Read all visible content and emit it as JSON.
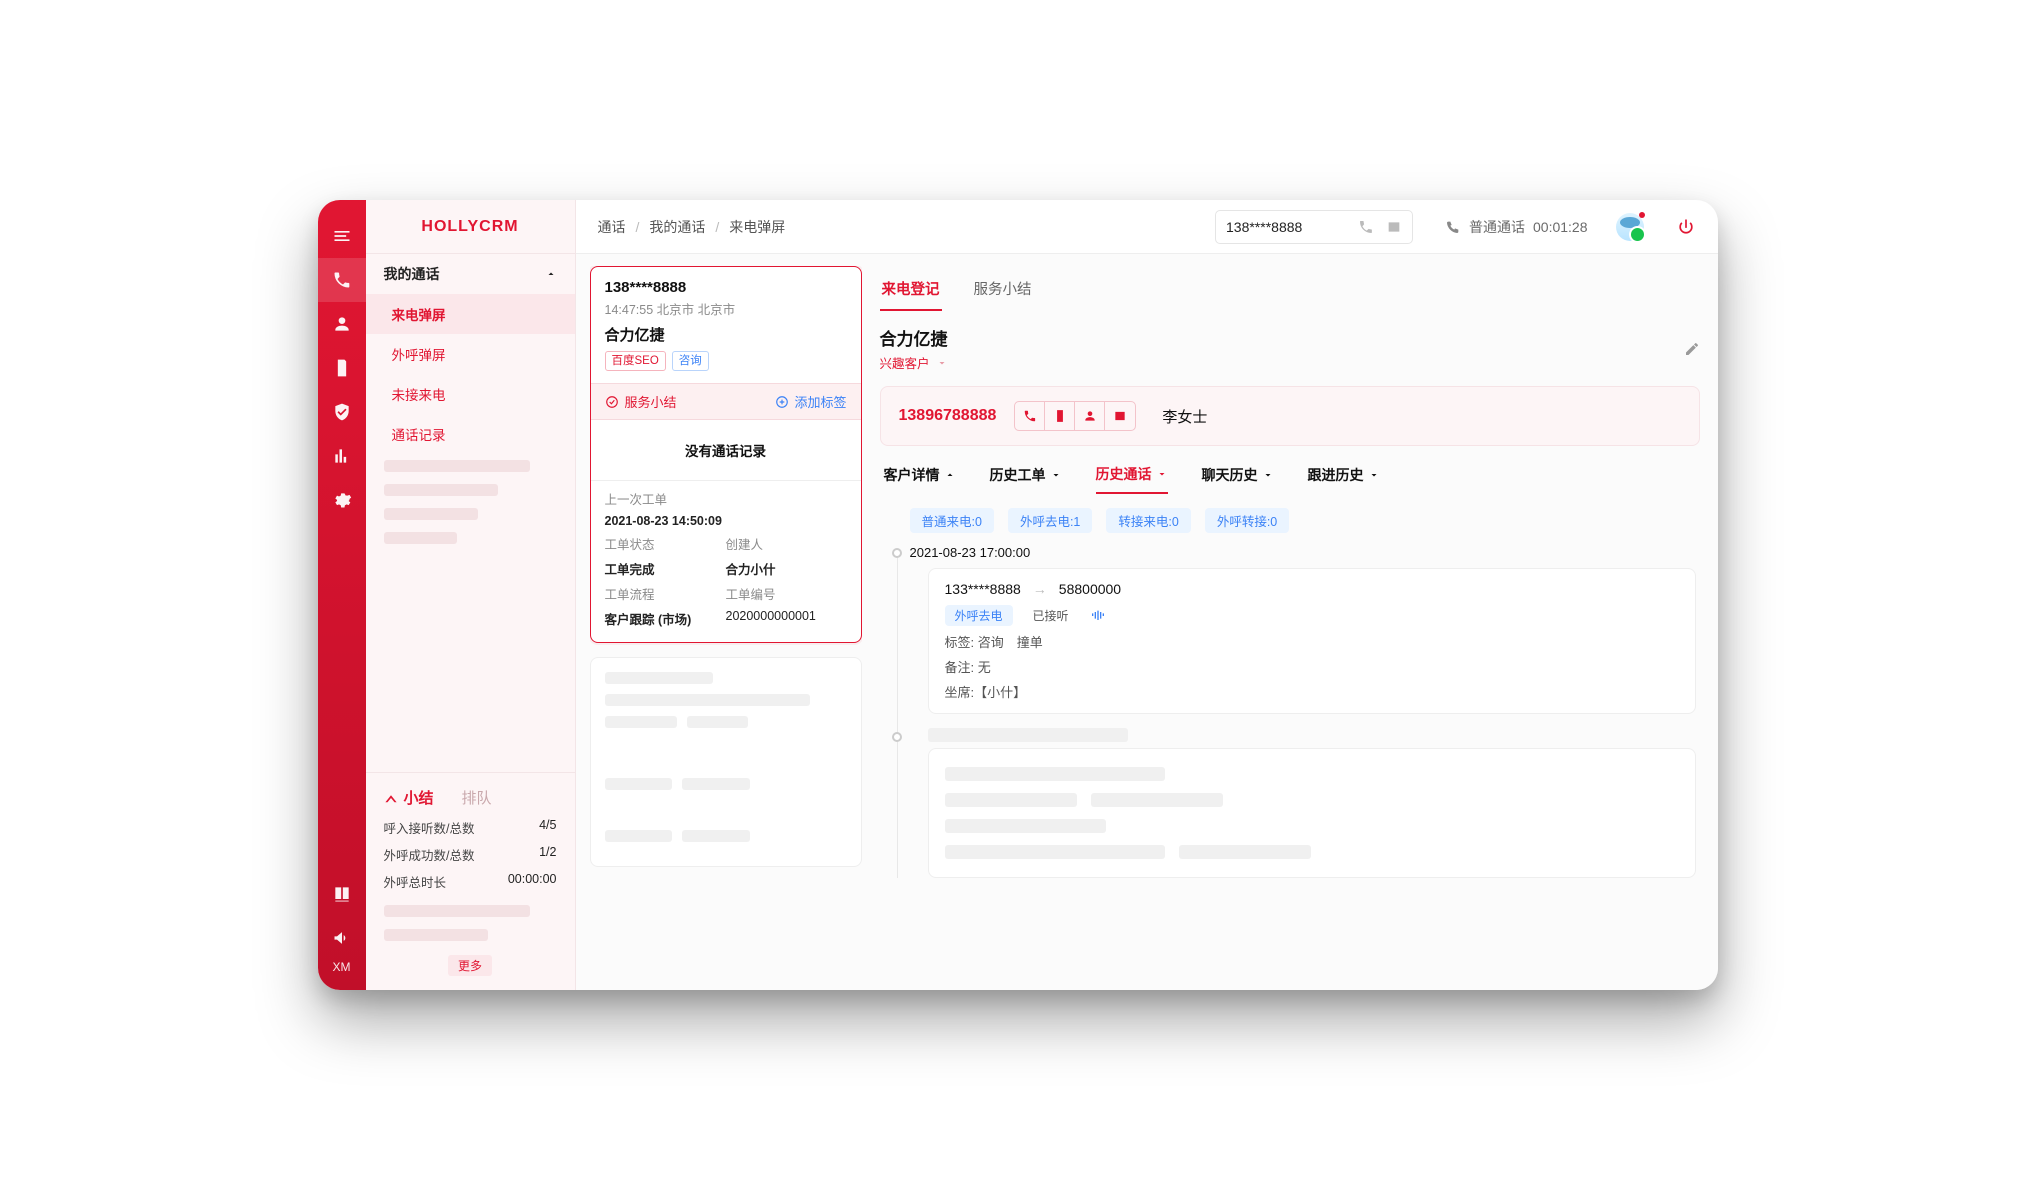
{
  "brand": "HOLLYCRM",
  "breadcrumb": [
    "通话",
    "我的通话",
    "来电弹屏"
  ],
  "topbar": {
    "phone_value": "138****8888",
    "status_label": "普通通话",
    "timer": "00:01:28"
  },
  "sidebar": {
    "group_label": "我的通话",
    "items": [
      "来电弹屏",
      "外呼弹屏",
      "未接来电",
      "通话记录"
    ],
    "active_index": 0,
    "bottom_tabs": [
      "小结",
      "排队"
    ],
    "stats": [
      {
        "k": "呼入接听数/总数",
        "v": "4/5"
      },
      {
        "k": "外呼成功数/总数",
        "v": "1/2"
      },
      {
        "k": "外呼总时长",
        "v": "00:00:00"
      }
    ],
    "more_label": "更多"
  },
  "call_card": {
    "number": "138****8888",
    "meta": "14:47:55 北京市 北京市",
    "corp": "合力亿捷",
    "tags": [
      {
        "text": "百度SEO",
        "kind": "red"
      },
      {
        "text": "咨询",
        "kind": "blue"
      }
    ],
    "svc_label": "服务小结",
    "add_tag_label": "添加标签",
    "no_record": "没有通话记录",
    "last_ticket_label": "上一次工单",
    "last_ticket_time": "2021-08-23 14:50:09",
    "fields": [
      {
        "lbl": "工单状态",
        "val": "",
        "lbl2": "创建人",
        "val2": ""
      },
      {
        "lbl": "工单完成",
        "val": "",
        "lbl2": "合力小什",
        "val2": ""
      },
      {
        "lbl": "工单流程",
        "val": "",
        "lbl2": "工单编号",
        "val2": ""
      },
      {
        "lbl": "客户跟踪 (市场)",
        "val": "",
        "lbl2": "2020000000001",
        "val2": "",
        "link": true
      }
    ]
  },
  "right": {
    "tabs": [
      "来电登记",
      "服务小结"
    ],
    "active_tab": 0,
    "customer_name": "合力亿捷",
    "customer_sub": "兴趣客户",
    "phone_big": "13896788888",
    "contact_name": "李女士",
    "sub_tabs": [
      {
        "label": "客户详情",
        "dir": "up"
      },
      {
        "label": "历史工单",
        "dir": "down"
      },
      {
        "label": "历史通话",
        "dir": "down",
        "active": true
      },
      {
        "label": "聊天历史",
        "dir": "down"
      },
      {
        "label": "跟进历史",
        "dir": "down"
      }
    ],
    "filters": [
      "普通来电:0",
      "外呼去电:1",
      "转接来电:0",
      "外呼转接:0"
    ],
    "timeline_time": "2021-08-23  17:00:00",
    "call": {
      "from": "133****8888",
      "to": "58800000",
      "chip_type": "外呼去电",
      "chip_status": "已接听",
      "tags_label": "标签:",
      "tags_value": "咨询　撞单",
      "note_label": "备注:",
      "note_value": "无",
      "agent_label": "坐席:",
      "agent_value": "【小什】"
    }
  }
}
